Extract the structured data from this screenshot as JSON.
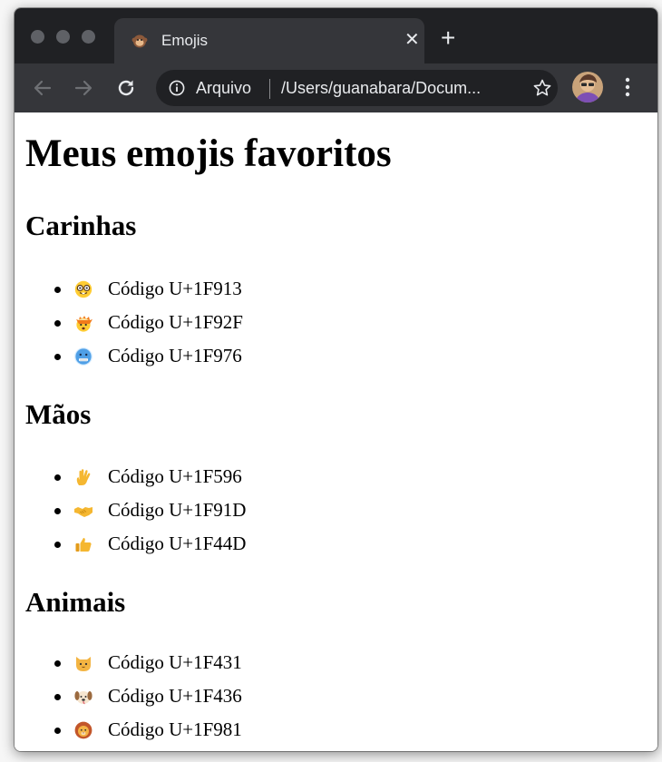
{
  "browser": {
    "tab_title": "Emojis",
    "tab_close": "✕",
    "new_tab": "+",
    "security_label": "Arquivo",
    "url": "/Users/guanabara/Docum..."
  },
  "page": {
    "heading": "Meus emojis favoritos",
    "sections": [
      {
        "title": "Carinhas",
        "items": [
          {
            "emoji": "nerd-face-icon",
            "text": "Código U+1F913"
          },
          {
            "emoji": "exploding-head-icon",
            "text": "Código U+1F92F"
          },
          {
            "emoji": "cold-face-icon",
            "text": "Código U+1F976"
          }
        ]
      },
      {
        "title": "Mãos",
        "items": [
          {
            "emoji": "vulcan-salute-icon",
            "text": "Código U+1F596"
          },
          {
            "emoji": "handshake-icon",
            "text": "Código U+1F91D"
          },
          {
            "emoji": "thumbs-up-icon",
            "text": "Código U+1F44D"
          }
        ]
      },
      {
        "title": "Animais",
        "items": [
          {
            "emoji": "cat-face-icon",
            "text": "Código U+1F431"
          },
          {
            "emoji": "dog-face-icon",
            "text": "Código U+1F436"
          },
          {
            "emoji": "lion-face-icon",
            "text": "Código U+1F981"
          }
        ]
      }
    ]
  },
  "colors": {
    "titlebar": "#202124",
    "toolbar": "#35363a",
    "page_background": "#ffffff",
    "text": "#000000"
  }
}
